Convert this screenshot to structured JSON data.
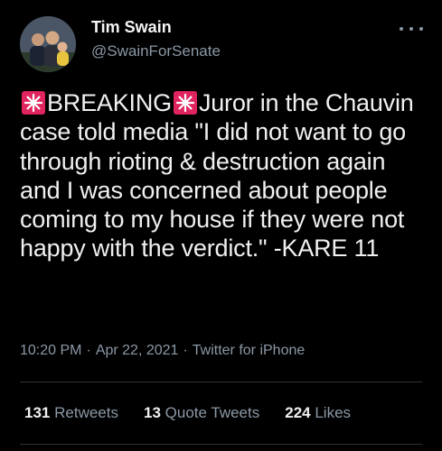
{
  "author": {
    "name": "Tim Swain",
    "handle": "@SwainForSenate",
    "avatar_icon": "profile-photo"
  },
  "tweet": {
    "lead_word": "BREAKING",
    "body_rest": "Juror in the Chauvin case told media \"I did not want to go through rioting & destruction again and I was concerned about people coming to my house if they were not happy with the verdict.\" -KARE 11",
    "emoji_icon": "siren-icon",
    "time": "10:20 PM",
    "date": "Apr 22, 2021",
    "source": "Twitter for iPhone"
  },
  "stats": {
    "retweets_count": "131",
    "retweets_label": "Retweets",
    "quotes_count": "13",
    "quotes_label": "Quote Tweets",
    "likes_count": "224",
    "likes_label": "Likes"
  },
  "colors": {
    "background": "#000000",
    "text": "#e7e9ea",
    "secondary_text": "#8b98a5",
    "divider": "#2f3336",
    "siren_red": "#e0245e"
  }
}
